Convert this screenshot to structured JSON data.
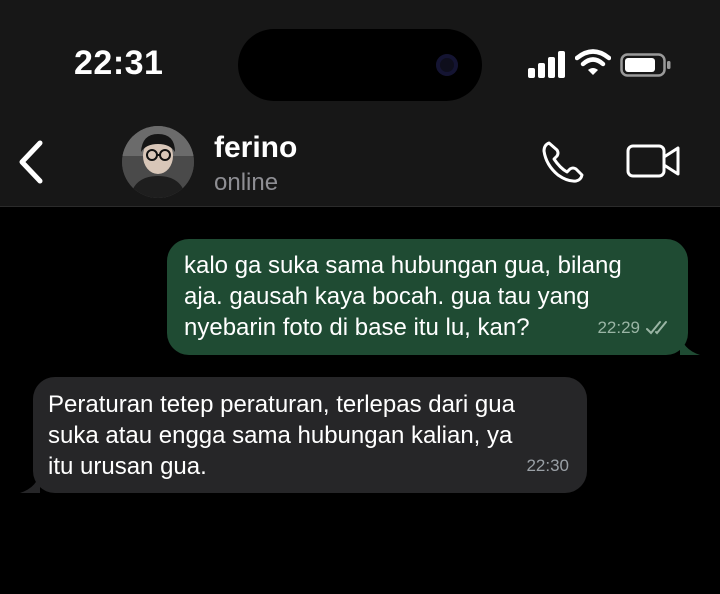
{
  "status_bar": {
    "time": "22:31",
    "icons": [
      "signal-icon",
      "wifi-icon",
      "battery-icon"
    ]
  },
  "header": {
    "back_icon": "chevron-left-icon",
    "contact_name": "ferino",
    "contact_status": "online",
    "actions": [
      "phone-icon",
      "video-camera-icon"
    ]
  },
  "messages": [
    {
      "direction": "outgoing",
      "text": "kalo ga suka sama hubungan gua, bilang\naja. gausah kaya bocah. gua tau yang\nnyebarin foto di base itu lu, kan?",
      "time": "22:29",
      "status_icon": "double-check-icon"
    },
    {
      "direction": "incoming",
      "text": "Peraturan tetep peraturan, terlepas dari gua\nsuka atau engga sama hubungan kalian, ya\nitu urusan gua.",
      "time": "22:30"
    }
  ],
  "colors": {
    "header_bg": "#171717",
    "outgoing_bubble": "#1f4b33",
    "incoming_bubble": "#262628",
    "chat_bg": "#000000"
  }
}
